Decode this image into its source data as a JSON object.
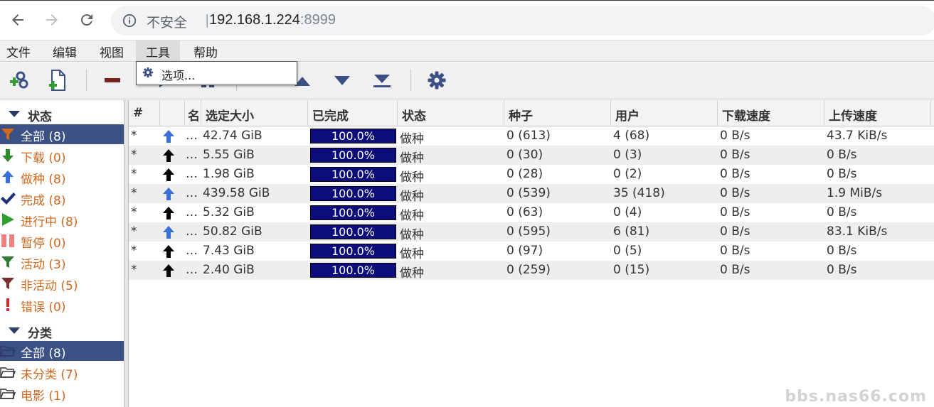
{
  "browser": {
    "security_label": "不安全",
    "separator": "|",
    "host": "192.168.1.224",
    "port": ":8999"
  },
  "menubar": {
    "items": [
      "文件",
      "编辑",
      "视图",
      "工具",
      "帮助"
    ]
  },
  "dropdown": {
    "option": "选项..."
  },
  "sidebar": {
    "status_title": "状态",
    "status_items": [
      {
        "label": "全部 (8)",
        "icon": "filter-icon",
        "color": "#d2691e"
      },
      {
        "label": "下载 (0)",
        "icon": "download-arrow-icon",
        "color": "#2e8b2e"
      },
      {
        "label": "做种 (8)",
        "icon": "upload-arrow-icon",
        "color": "#3a6fd8"
      },
      {
        "label": "完成 (8)",
        "icon": "checkmark-icon",
        "color": "#1e2f7a"
      },
      {
        "label": "进行中 (8)",
        "icon": "play-icon",
        "color": "#2e8b2e"
      },
      {
        "label": "暂停 (0)",
        "icon": "pause-icon",
        "color": "#f08080"
      },
      {
        "label": "活动 (3)",
        "icon": "filter-active-icon",
        "color": "#2e7d32"
      },
      {
        "label": "非活动 (5)",
        "icon": "filter-inactive-icon",
        "color": "#8b2e2e"
      },
      {
        "label": "错误 (0)",
        "icon": "error-icon",
        "color": "#d62828"
      }
    ],
    "category_title": "分类",
    "category_items": [
      {
        "label": "全部 (8)",
        "icon": "folder-icon"
      },
      {
        "label": "未分类 (7)",
        "icon": "folder-icon"
      },
      {
        "label": "电影 (1)",
        "icon": "folder-icon"
      }
    ]
  },
  "table": {
    "headers": [
      "#",
      "",
      "名",
      "选定大小",
      "已完成",
      "状态",
      "种子",
      "用户",
      "下载速度",
      "上传速度"
    ],
    "rows": [
      {
        "num": "*",
        "arrow": "blue",
        "name": "…",
        "size": "42.74 GiB",
        "done": "100.0%",
        "state": "做种",
        "seeds": "0 (613)",
        "peers": "4 (68)",
        "down": "0 B/s",
        "up": "43.7 KiB/s"
      },
      {
        "num": "*",
        "arrow": "black",
        "name": "…",
        "size": "5.55 GiB",
        "done": "100.0%",
        "state": "做种",
        "seeds": "0 (30)",
        "peers": "0 (3)",
        "down": "0 B/s",
        "up": "0 B/s"
      },
      {
        "num": "*",
        "arrow": "black",
        "name": "…",
        "size": "1.98 GiB",
        "done": "100.0%",
        "state": "做种",
        "seeds": "0 (28)",
        "peers": "0 (2)",
        "down": "0 B/s",
        "up": "0 B/s"
      },
      {
        "num": "*",
        "arrow": "blue",
        "name": "…",
        "size": "439.58 GiB",
        "done": "100.0%",
        "state": "做种",
        "seeds": "0 (539)",
        "peers": "35 (418)",
        "down": "0 B/s",
        "up": "1.9 MiB/s"
      },
      {
        "num": "*",
        "arrow": "black",
        "name": "…",
        "size": "5.32 GiB",
        "done": "100.0%",
        "state": "做种",
        "seeds": "0 (63)",
        "peers": "0 (4)",
        "down": "0 B/s",
        "up": "0 B/s"
      },
      {
        "num": "*",
        "arrow": "blue",
        "name": "…",
        "size": "50.82 GiB",
        "done": "100.0%",
        "state": "做种",
        "seeds": "0 (595)",
        "peers": "6 (81)",
        "down": "0 B/s",
        "up": "83.1 KiB/s"
      },
      {
        "num": "*",
        "arrow": "black",
        "name": "…",
        "size": "7.43 GiB",
        "done": "100.0%",
        "state": "做种",
        "seeds": "0 (97)",
        "peers": "0 (5)",
        "down": "0 B/s",
        "up": "0 B/s"
      },
      {
        "num": "*",
        "arrow": "black",
        "name": "…",
        "size": "2.40 GiB",
        "done": "100.0%",
        "state": "做种",
        "seeds": "0 (259)",
        "peers": "0 (15)",
        "down": "0 B/s",
        "up": "0 B/s"
      }
    ]
  },
  "watermark": "bbs.nas66.com",
  "colors": {
    "selection": "#3b5084",
    "progress": "#0c0c7a",
    "accent_blue": "#3a6fd8"
  }
}
